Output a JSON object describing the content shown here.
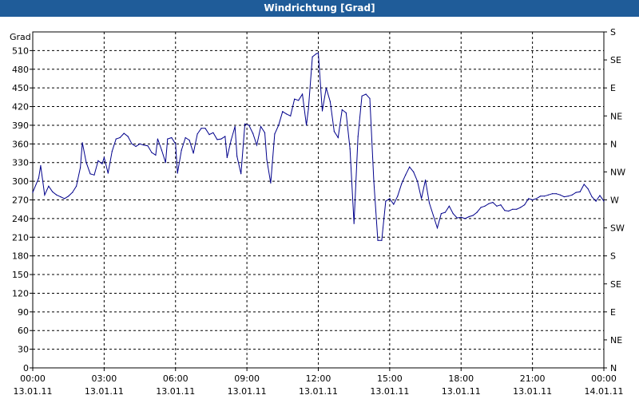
{
  "window": {
    "title": "Windrichtung [Grad]"
  },
  "chart_data": {
    "type": "line",
    "title": "Windrichtung [Grad]",
    "ylabel": "Grad",
    "ylim": [
      0,
      540
    ],
    "y_ticks": [
      0,
      30,
      60,
      90,
      120,
      150,
      180,
      210,
      240,
      270,
      300,
      330,
      360,
      390,
      420,
      450,
      480,
      510
    ],
    "right_ticks": [
      {
        "v": 0,
        "label": "N"
      },
      {
        "v": 30,
        "label": "NE"
      },
      {
        "v": 60,
        "label": "E"
      },
      {
        "v": 90,
        "label": "SE"
      },
      {
        "v": 120,
        "label": "S"
      },
      {
        "v": 150,
        "label": "SW"
      },
      {
        "v": 180,
        "label": "W"
      },
      {
        "v": 210,
        "label": "NW"
      },
      {
        "v": 240,
        "label": "N"
      },
      {
        "v": 270,
        "label": "NE"
      },
      {
        "v": 300,
        "label": "E"
      },
      {
        "v": 330,
        "label": "SE"
      },
      {
        "v": 360,
        "label": "S"
      }
    ],
    "x_ticks": [
      {
        "time": "00:00",
        "date": "13.01.11"
      },
      {
        "time": "03:00",
        "date": "13.01.11"
      },
      {
        "time": "06:00",
        "date": "13.01.11"
      },
      {
        "time": "09:00",
        "date": "13.01.11"
      },
      {
        "time": "12:00",
        "date": "13.01.11"
      },
      {
        "time": "15:00",
        "date": "13.01.11"
      },
      {
        "time": "18:00",
        "date": "13.01.11"
      },
      {
        "time": "21:00",
        "date": "13.01.11"
      },
      {
        "time": "00:00",
        "date": "14.01.11"
      }
    ],
    "grid": true,
    "series": [
      {
        "color": "#00008b",
        "points": [
          [
            "00:00",
            282
          ],
          [
            "00:15",
            305
          ],
          [
            "00:20",
            325
          ],
          [
            "00:30",
            278
          ],
          [
            "00:40",
            292
          ],
          [
            "00:50",
            283
          ],
          [
            "01:00",
            278
          ],
          [
            "01:10",
            275
          ],
          [
            "01:20",
            272
          ],
          [
            "01:30",
            276
          ],
          [
            "01:40",
            282
          ],
          [
            "01:50",
            292
          ],
          [
            "02:00",
            322
          ],
          [
            "02:05",
            362
          ],
          [
            "02:15",
            330
          ],
          [
            "02:25",
            312
          ],
          [
            "02:35",
            310
          ],
          [
            "02:45",
            333
          ],
          [
            "02:55",
            328
          ],
          [
            "03:00",
            338
          ],
          [
            "03:10",
            313
          ],
          [
            "03:20",
            348
          ],
          [
            "03:30",
            368
          ],
          [
            "03:40",
            370
          ],
          [
            "03:50",
            377
          ],
          [
            "04:00",
            372
          ],
          [
            "04:10",
            360
          ],
          [
            "04:20",
            356
          ],
          [
            "04:30",
            360
          ],
          [
            "04:40",
            358
          ],
          [
            "04:50",
            357
          ],
          [
            "05:00",
            346
          ],
          [
            "05:10",
            342
          ],
          [
            "05:15",
            368
          ],
          [
            "05:25",
            350
          ],
          [
            "05:35",
            330
          ],
          [
            "05:40",
            368
          ],
          [
            "05:50",
            370
          ],
          [
            "06:00",
            360
          ],
          [
            "06:05",
            313
          ],
          [
            "06:15",
            350
          ],
          [
            "06:25",
            370
          ],
          [
            "06:35",
            366
          ],
          [
            "06:45",
            345
          ],
          [
            "06:55",
            376
          ],
          [
            "07:05",
            385
          ],
          [
            "07:15",
            385
          ],
          [
            "07:25",
            375
          ],
          [
            "07:35",
            378
          ],
          [
            "07:45",
            367
          ],
          [
            "07:55",
            368
          ],
          [
            "08:05",
            372
          ],
          [
            "08:10",
            338
          ],
          [
            "08:20",
            366
          ],
          [
            "08:30",
            388
          ],
          [
            "08:35",
            340
          ],
          [
            "08:45",
            312
          ],
          [
            "08:55",
            392
          ],
          [
            "09:05",
            390
          ],
          [
            "09:15",
            377
          ],
          [
            "09:25",
            358
          ],
          [
            "09:35",
            388
          ],
          [
            "09:45",
            378
          ],
          [
            "09:50",
            335
          ],
          [
            "10:00",
            297
          ],
          [
            "10:10",
            376
          ],
          [
            "10:20",
            390
          ],
          [
            "10:30",
            412
          ],
          [
            "10:40",
            408
          ],
          [
            "10:50",
            405
          ],
          [
            "11:00",
            432
          ],
          [
            "11:10",
            430
          ],
          [
            "11:20",
            440
          ],
          [
            "11:30",
            390
          ],
          [
            "11:35",
            416
          ],
          [
            "11:45",
            500
          ],
          [
            "11:55",
            505
          ],
          [
            "12:00",
            506
          ],
          [
            "12:10",
            413
          ],
          [
            "12:20",
            450
          ],
          [
            "12:30",
            428
          ],
          [
            "12:40",
            380
          ],
          [
            "12:50",
            370
          ],
          [
            "13:00",
            415
          ],
          [
            "13:10",
            410
          ],
          [
            "13:20",
            352
          ],
          [
            "13:30",
            232
          ],
          [
            "13:40",
            372
          ],
          [
            "13:50",
            437
          ],
          [
            "14:00",
            440
          ],
          [
            "14:10",
            433
          ],
          [
            "14:20",
            300
          ],
          [
            "14:30",
            205
          ],
          [
            "14:40",
            205
          ],
          [
            "14:50",
            268
          ],
          [
            "15:00",
            272
          ],
          [
            "15:10",
            263
          ],
          [
            "15:20",
            276
          ],
          [
            "15:30",
            296
          ],
          [
            "15:40",
            310
          ],
          [
            "15:50",
            323
          ],
          [
            "16:00",
            315
          ],
          [
            "16:10",
            300
          ],
          [
            "16:20",
            272
          ],
          [
            "16:30",
            302
          ],
          [
            "16:40",
            265
          ],
          [
            "16:50",
            245
          ],
          [
            "17:00",
            225
          ],
          [
            "17:10",
            248
          ],
          [
            "17:20",
            250
          ],
          [
            "17:30",
            260
          ],
          [
            "17:40",
            248
          ],
          [
            "17:50",
            241
          ],
          [
            "18:00",
            242
          ],
          [
            "18:10",
            240
          ],
          [
            "18:20",
            243
          ],
          [
            "18:30",
            245
          ],
          [
            "18:40",
            250
          ],
          [
            "18:50",
            258
          ],
          [
            "19:00",
            260
          ],
          [
            "19:10",
            264
          ],
          [
            "19:20",
            266
          ],
          [
            "19:30",
            260
          ],
          [
            "19:40",
            262
          ],
          [
            "19:50",
            253
          ],
          [
            "20:00",
            252
          ],
          [
            "20:10",
            255
          ],
          [
            "20:20",
            255
          ],
          [
            "20:30",
            258
          ],
          [
            "20:40",
            262
          ],
          [
            "20:50",
            272
          ],
          [
            "21:00",
            270
          ],
          [
            "21:10",
            272
          ],
          [
            "21:20",
            276
          ],
          [
            "21:30",
            276
          ],
          [
            "21:40",
            278
          ],
          [
            "21:50",
            280
          ],
          [
            "22:00",
            280
          ],
          [
            "22:10",
            278
          ],
          [
            "22:20",
            275
          ],
          [
            "22:30",
            276
          ],
          [
            "22:40",
            278
          ],
          [
            "22:50",
            282
          ],
          [
            "23:00",
            283
          ],
          [
            "23:10",
            295
          ],
          [
            "23:20",
            288
          ],
          [
            "23:30",
            275
          ],
          [
            "23:40",
            268
          ],
          [
            "23:50",
            277
          ],
          [
            "24:00",
            268
          ]
        ]
      }
    ]
  }
}
